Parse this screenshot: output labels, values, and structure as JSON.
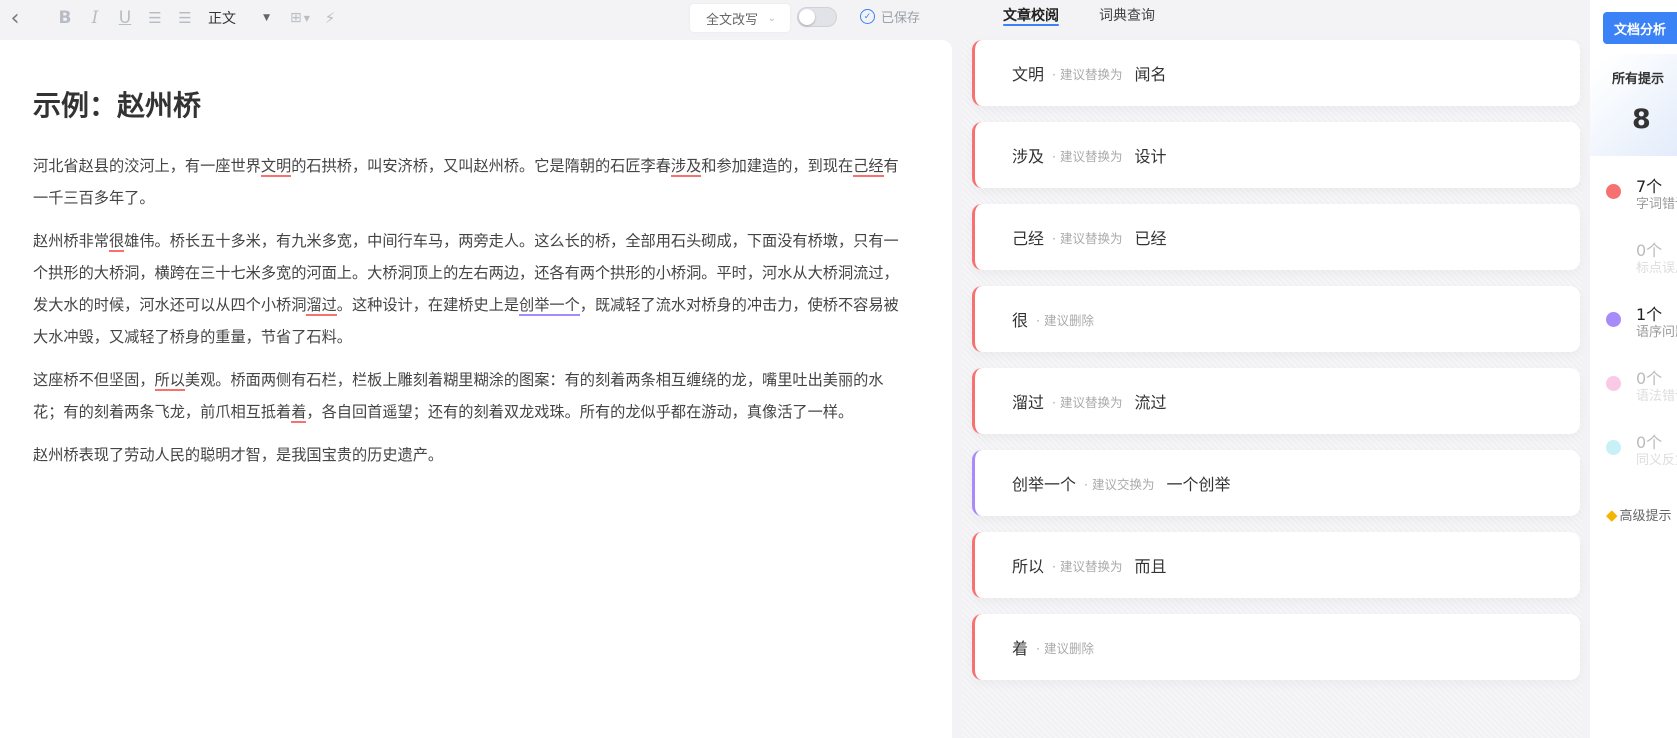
{
  "toolbar": {
    "back": "‹",
    "bold": "B",
    "italic": "I",
    "underline": "U",
    "ordered_list": "☰",
    "unordered_list": "☰",
    "style": "正文",
    "table": "⊞",
    "bolt": "⚡"
  },
  "rewrite": {
    "label": "全文改写"
  },
  "saved": {
    "label": "已保存"
  },
  "tabs": [
    {
      "label": "文章校阅",
      "active": true
    },
    {
      "label": "词典查询",
      "active": false
    }
  ],
  "document": {
    "title": "示例：赵州桥",
    "p1": [
      "河北省赵县的洨河上，有一座世界",
      "文明",
      "的石拱桥，叫安济桥，又叫赵州桥。它是隋朝的石匠李春",
      "涉及",
      "和参加建造的，到现在",
      "己经",
      "有一千三百多年了。"
    ],
    "p2": [
      "赵州桥非常",
      "很",
      "雄伟。桥长五十多米，有九米多宽，中间行车马，两旁走人。这么长的桥，全部用石头砌成，下面没有桥墩，只有一个拱形的大桥洞，横跨在三十七米多宽的河面上。大桥洞顶上的左右两边，还各有两个拱形的小桥洞。平时，河水从大桥洞流过，发大水的时候，河水还可以从四个小桥洞",
      "溜过",
      "。这种设计，在建桥史上是",
      "创举一个",
      "，既减轻了流水对桥身的冲击力，使桥不容易被大水冲毁，又减轻了桥身的重量，节省了石料。"
    ],
    "p3": [
      "这座桥不但坚固，",
      "所以",
      "美观。桥面两侧有石栏，栏板上雕刻着糊里糊涂的图案：有的刻着两条相互缠绕的龙，嘴里吐出美丽的水花；有的刻着两条飞龙，前爪相互抵着",
      "着",
      "，各自回首遥望；还有的刻着双龙戏珠。所有的龙似乎都在游动，真像活了一样。"
    ],
    "p4": "赵州桥表现了劳动人民的聪明才智，是我国宝贵的历史遗产。"
  },
  "suggestions": [
    {
      "original": "文明",
      "hint": "建议替换为",
      "replacement": "闻名"
    },
    {
      "original": "涉及",
      "hint": "建议替换为",
      "replacement": "设计"
    },
    {
      "original": "己经",
      "hint": "建议替换为",
      "replacement": "已经"
    },
    {
      "original": "很",
      "hint": "建议删除",
      "replacement": ""
    },
    {
      "original": "溜过",
      "hint": "建议替换为",
      "replacement": "流过"
    },
    {
      "original": "创举一个",
      "hint": "建议交换为",
      "replacement": "一个创举"
    },
    {
      "original": "所以",
      "hint": "建议替换为",
      "replacement": "而且"
    },
    {
      "original": "着",
      "hint": "建议删除",
      "replacement": ""
    }
  ],
  "sidebar": {
    "analyze_button": "文档分析",
    "all_label": "所有提示",
    "all_count": "8",
    "stats": [
      {
        "count": "7个",
        "label": "字词错误",
        "color": "#f87171"
      },
      {
        "count": "0个",
        "label": "标点误用",
        "color": "#ffffff"
      },
      {
        "count": "1个",
        "label": "语序问题",
        "color": "#a78bfa"
      },
      {
        "count": "0个",
        "label": "语法错误",
        "color": "#f9c9e6"
      },
      {
        "count": "0个",
        "label": "同义反复",
        "color": "#c7f0f7"
      }
    ],
    "advanced": "高级提示"
  },
  "colors": {
    "accent": "#3b82f6",
    "error_red": "#f87171",
    "error_purple": "#a78bfa"
  }
}
